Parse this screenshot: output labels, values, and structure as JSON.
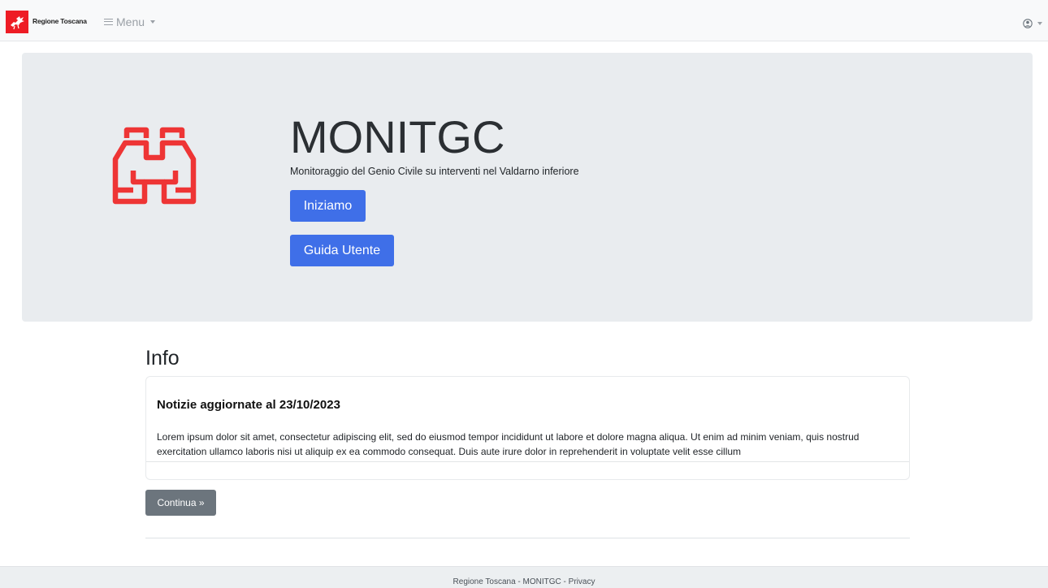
{
  "navbar": {
    "brand": "Regione Toscana",
    "menu_label": "Menu",
    "icons": {
      "logo": "pegasus-logo",
      "menu": "hamburger-icon",
      "user": "user-circle-icon"
    }
  },
  "hero": {
    "title": "MONITGC",
    "subtitle": "Monitoraggio del Genio Civile su interventi nel Valdarno inferiore",
    "start_button": "Iniziamo",
    "guide_button": "Guida Utente",
    "icon": "binoculars-icon",
    "accent_color": "#ee3535"
  },
  "info": {
    "title": "Info",
    "news_title": "Notizie aggiornate al 23/10/2023",
    "news_body": "Lorem ipsum dolor sit amet, consectetur adipiscing elit, sed do eiusmod tempor incididunt ut labore et dolore magna aliqua. Ut enim ad minim veniam, quis nostrud exercitation ullamco laboris nisi ut aliquip ex ea commodo consequat. Duis aute irure dolor in reprehenderit in voluptate velit esse cillum",
    "continue_button": "Continua »"
  },
  "footer": {
    "org": "Regione Toscana",
    "sep1": " - ",
    "app": "MONITGC",
    "sep2": " - ",
    "privacy": "Privacy"
  }
}
